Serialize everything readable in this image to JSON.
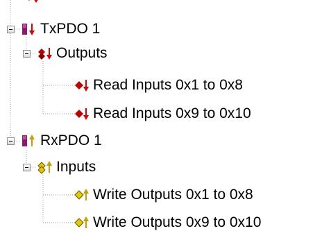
{
  "tree": {
    "nodes": [
      {
        "id": "txpdo",
        "label": "TxPDO 1",
        "icon": "pdo-input-icon",
        "expanded": true
      },
      {
        "id": "outputs",
        "label": "Outputs",
        "icon": "variable-group-input-icon",
        "expanded": true
      },
      {
        "id": "read1",
        "label": "Read Inputs 0x1 to 0x8",
        "icon": "variable-input-icon"
      },
      {
        "id": "read2",
        "label": "Read Inputs 0x9 to 0x10",
        "icon": "variable-input-icon"
      },
      {
        "id": "rxpdo",
        "label": "RxPDO 1",
        "icon": "pdo-output-icon",
        "expanded": true
      },
      {
        "id": "inputs",
        "label": "Inputs",
        "icon": "variable-group-output-icon",
        "expanded": true
      },
      {
        "id": "write1",
        "label": "Write Outputs 0x1 to 0x8",
        "icon": "variable-output-icon"
      },
      {
        "id": "write2",
        "label": "Write Outputs 0x9 to 0x10",
        "icon": "variable-output-icon"
      }
    ]
  },
  "colors": {
    "input_arrow": "#e00000",
    "output_arrow": "#c8a000",
    "pdo_block": "#8b1a6b",
    "variable_input": "#c00000",
    "variable_output": "#e6c800",
    "guide_line": "#a0a0a0"
  }
}
